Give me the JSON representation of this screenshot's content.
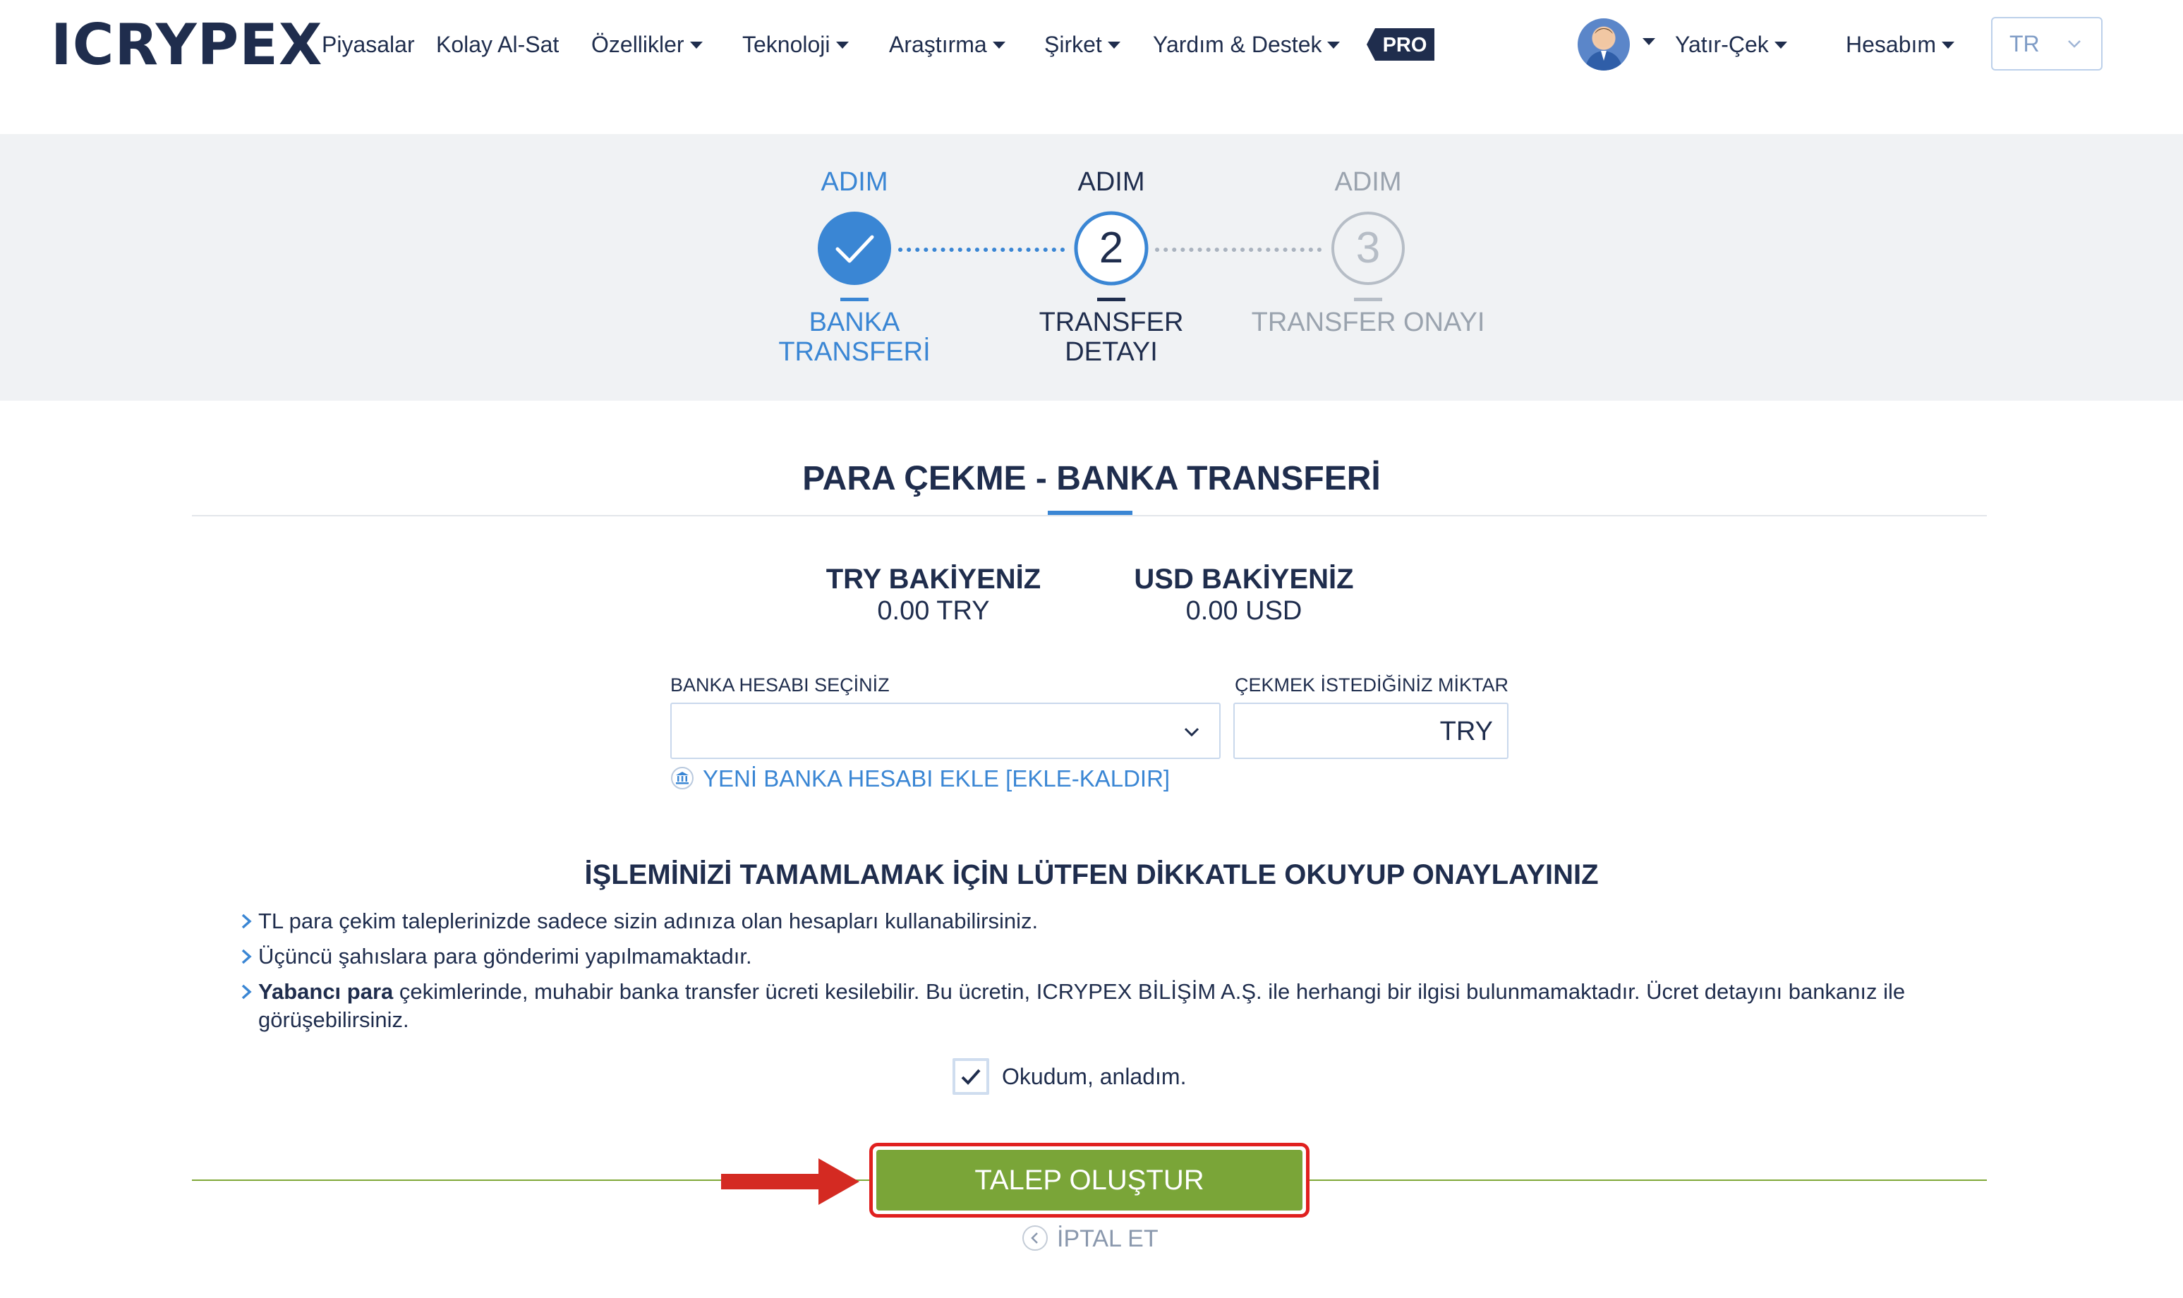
{
  "brand": {
    "logo_text": "ICRYPEX"
  },
  "nav": {
    "items": [
      {
        "label": "Piyasalar",
        "dropdown": false
      },
      {
        "label": "Kolay Al-Sat",
        "dropdown": false
      },
      {
        "label": "Özellikler",
        "dropdown": true
      },
      {
        "label": "Teknoloji",
        "dropdown": true
      },
      {
        "label": "Araştırma",
        "dropdown": true
      },
      {
        "label": "Şirket",
        "dropdown": true
      },
      {
        "label": "Yardım & Destek",
        "dropdown": true
      }
    ],
    "pro_label": "PRO",
    "deposit_withdraw": "Yatır-Çek",
    "account": "Hesabım",
    "language": "TR"
  },
  "steps": [
    {
      "top": "ADIM",
      "label_line1": "BANKA",
      "label_line2": "TRANSFERİ",
      "state": "done",
      "number": "1"
    },
    {
      "top": "ADIM",
      "label_line1": "TRANSFER",
      "label_line2": "DETAYI",
      "state": "active",
      "number": "2"
    },
    {
      "top": "ADIM",
      "label_line1": "TRANSFER ONAYI",
      "label_line2": "",
      "state": "pending",
      "number": "3"
    }
  ],
  "page": {
    "title": "PARA ÇEKME - BANKA TRANSFERİ",
    "balances": [
      {
        "label": "TRY BAKİYENİZ",
        "value": "0.00 TRY"
      },
      {
        "label": "USD BAKİYENİZ",
        "value": "0.00 USD"
      }
    ],
    "bank_select_label": "BANKA HESABI SEÇİNİZ",
    "bank_select_value": "",
    "amount_label": "ÇEKMEK İSTEDİĞİNİZ MİKTAR",
    "amount_value": "",
    "amount_unit": "TRY",
    "add_bank_link": "YENİ BANKA HESABI EKLE [EKLE-KALDIR]",
    "notice_title": "İŞLEMİNİZİ TAMAMLAMAK İÇİN LÜTFEN DİKKATLE OKUYUP ONAYLAYINIZ",
    "rules": [
      {
        "bold": "",
        "text": "TL para çekim taleplerinizde sadece sizin adınıza olan hesapları kullanabilirsiniz."
      },
      {
        "bold": "",
        "text": "Üçüncü şahıslara para gönderimi yapılmamaktadır."
      },
      {
        "bold": "Yabancı para",
        "text": " çekimlerinde, muhabir banka transfer ücreti kesilebilir. Bu ücretin, ICRYPEX BİLİŞİM A.Ş. ile herhangi bir ilgisi bulunmamaktadır. Ücret detayını bankanız ile görüşebilirsiniz."
      }
    ],
    "consent_label": "Okudum, anladım.",
    "consent_checked": true,
    "submit_label": "TALEP OLUŞTUR",
    "cancel_label": "İPTAL ET"
  },
  "colors": {
    "primary_blue": "#3a86d4",
    "navy": "#1f2d4d",
    "submit_green": "#7aa538",
    "highlight_red": "#e0201f",
    "steps_bg": "#f0f2f4"
  }
}
